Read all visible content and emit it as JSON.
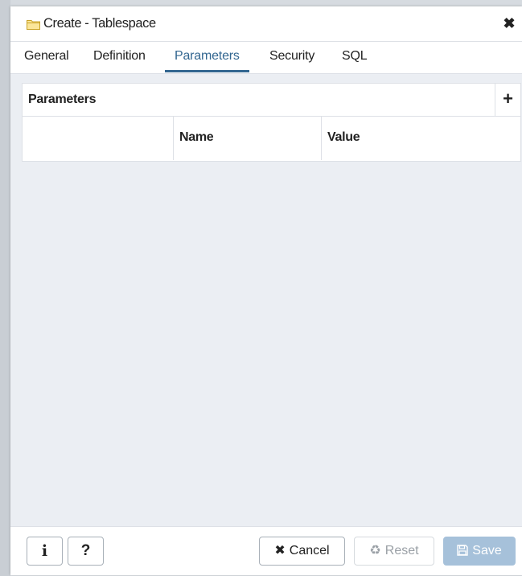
{
  "dialog": {
    "title": "Create - Tablespace",
    "title_icon": "folder-icon",
    "close_icon": "close-icon"
  },
  "tabs": [
    {
      "label": "General",
      "active": false
    },
    {
      "label": "Definition",
      "active": false
    },
    {
      "label": "Parameters",
      "active": true
    },
    {
      "label": "Security",
      "active": false
    },
    {
      "label": "SQL",
      "active": false
    }
  ],
  "parameters_panel": {
    "title": "Parameters",
    "add_label": "+",
    "columns": [
      "",
      "Name",
      "Value"
    ],
    "rows": []
  },
  "footer": {
    "info_label": "i",
    "help_label": "?",
    "cancel_label": "Cancel",
    "reset_label": "Reset",
    "save_label": "Save"
  },
  "colors": {
    "accent": "#326690",
    "save_disabled": "#a6c1da",
    "body_bg": "#ebeef3"
  }
}
